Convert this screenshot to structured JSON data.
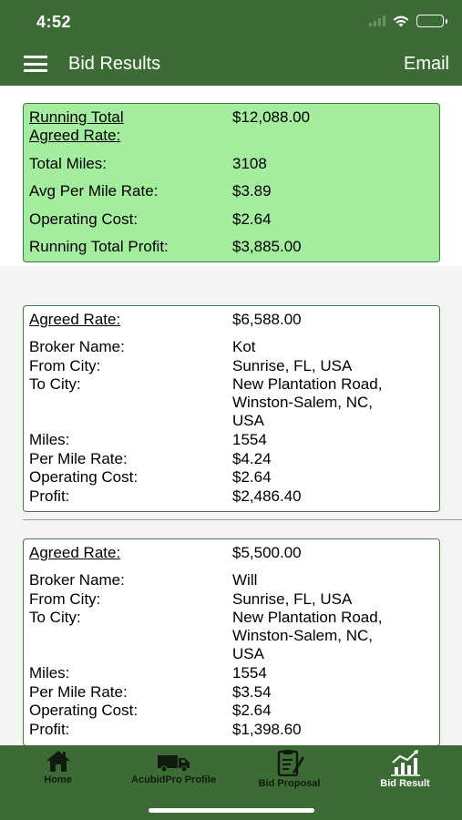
{
  "status": {
    "time": "4:52"
  },
  "nav": {
    "title": "Bid Results",
    "email_label": "Email",
    "menu_icon": "hamburger-menu-icon"
  },
  "summary": {
    "running_total_label": "Running Total Agreed Rate:",
    "running_total_label_line1": "Running Total",
    "running_total_label_line2": "Agreed Rate:",
    "running_total_value": "$12,088.00",
    "total_miles_label": "Total Miles:",
    "total_miles_value": "3108",
    "avg_rate_label": "Avg Per Mile Rate:",
    "avg_rate_value": "$3.89",
    "operating_cost_label": "Operating Cost:",
    "operating_cost_value": "$2.64",
    "profit_label": "Running Total Profit:",
    "profit_value": "$3,885.00"
  },
  "labels": {
    "agreed_rate": "Agreed Rate:",
    "broker_name": "Broker Name:",
    "from_city": "From City:",
    "to_city": "To City:",
    "miles": "Miles:",
    "per_mile_rate": "Per Mile Rate:",
    "operating_cost": "Operating Cost:",
    "profit": "Profit:"
  },
  "bids": [
    {
      "agreed_rate": "$6,588.00",
      "broker_name": "Kot",
      "from_city": "Sunrise, FL, USA",
      "to_city_lines": [
        "New Plantation Road,",
        "Winston-Salem, NC,",
        "USA"
      ],
      "miles": "1554",
      "per_mile_rate": "$4.24",
      "operating_cost": "$2.64",
      "profit": "$2,486.40"
    },
    {
      "agreed_rate": "$5,500.00",
      "broker_name": "Will",
      "from_city": "Sunrise, FL, USA",
      "to_city_lines": [
        "New Plantation Road,",
        "Winston-Salem, NC,",
        "USA"
      ],
      "miles": "1554",
      "per_mile_rate": "$3.54",
      "operating_cost": "$2.64",
      "profit": "$1,398.60"
    }
  ],
  "tabs": [
    {
      "label": "Home",
      "icon": "home-icon",
      "active": false
    },
    {
      "label": "AcubidPro Profile",
      "icon": "truck-icon",
      "active": false
    },
    {
      "label": "Bid Proposal",
      "icon": "clipboard-pen-icon",
      "active": false
    },
    {
      "label": "Bid Result",
      "icon": "bar-chart-trend-icon",
      "active": true
    }
  ],
  "colors": {
    "header": "#3d6b35",
    "summary_fill": "#a4ec9e",
    "card_border": "#4a7a44",
    "active_tab_text": "#ffffff"
  }
}
